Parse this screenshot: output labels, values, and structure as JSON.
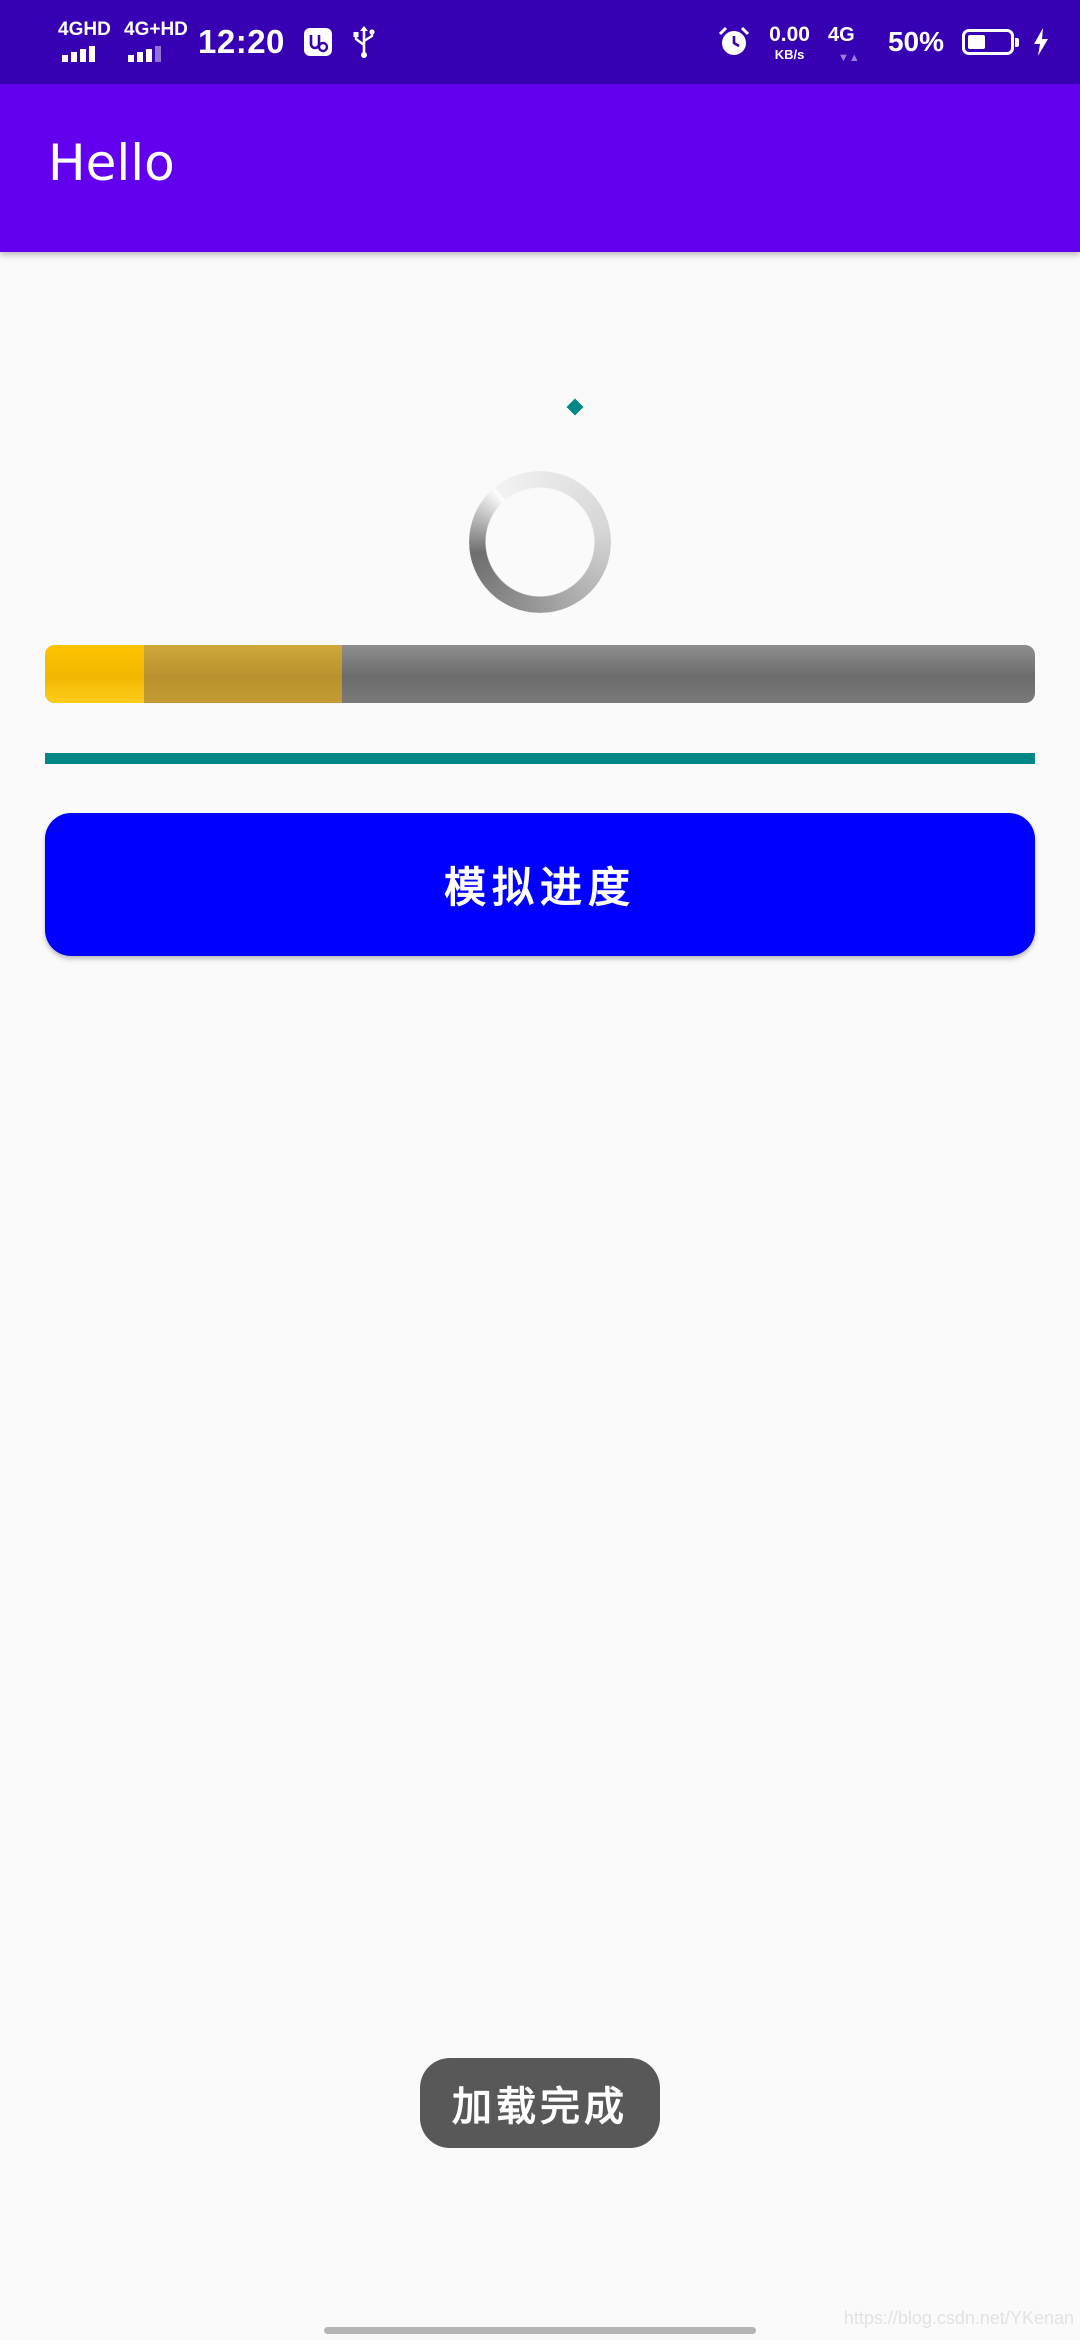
{
  "status_bar": {
    "sim1_label": "4GHD",
    "sim2_label": "4G+HD",
    "time": "12:20",
    "net_speed_value": "0.00",
    "net_speed_unit": "KB/s",
    "network_type": "4G",
    "battery_percent": "50%",
    "battery_level": 0.5
  },
  "toolbar": {
    "title": "Hello"
  },
  "progress": {
    "primary_fraction": 0.1,
    "secondary_fraction": 0.3
  },
  "actions": {
    "simulate_label": "模拟进度"
  },
  "toast": {
    "message": "加载完成"
  },
  "watermark": {
    "text": "https://blog.csdn.net/YKenan"
  },
  "colors": {
    "status_bar": "#3700b3",
    "toolbar": "#6200ee",
    "accent": "#018786",
    "button": "#0000ff",
    "progress_primary": "#ffc400",
    "progress_secondary": "#c49c34",
    "progress_track": "#7a7a7a",
    "toast": "#585858"
  },
  "icons": {
    "status_left": [
      "signal-icon",
      "signal-icon",
      "app-notification-icon",
      "usb-icon"
    ],
    "status_right": [
      "alarm-icon",
      "battery-icon",
      "charging-icon"
    ]
  }
}
